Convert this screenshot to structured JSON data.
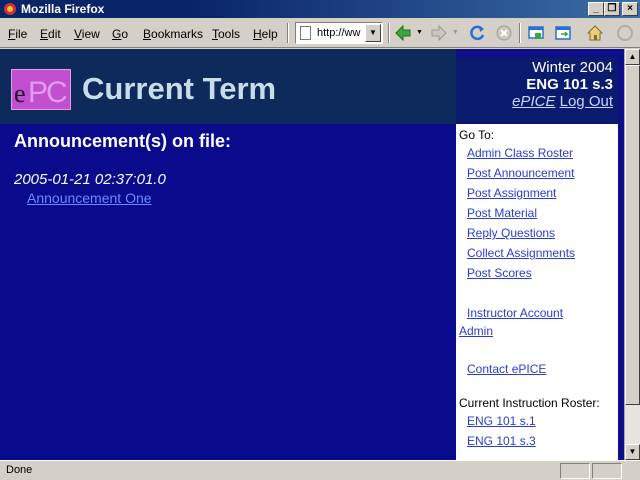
{
  "window": {
    "title": "Mozilla Firefox",
    "controls": [
      "_",
      "❐",
      "×"
    ]
  },
  "menu": {
    "items": [
      {
        "underline": "F",
        "rest": "ile"
      },
      {
        "underline": "E",
        "rest": "dit"
      },
      {
        "underline": "V",
        "rest": "iew"
      },
      {
        "underline": "G",
        "rest": "o"
      },
      {
        "underline": "B",
        "rest": "ookmarks"
      },
      {
        "underline": "T",
        "rest": "ools"
      },
      {
        "underline": "H",
        "rest": "elp"
      }
    ]
  },
  "address_bar": {
    "value": "http://ww"
  },
  "toolbar_icons": [
    "back-icon",
    "forward-icon",
    "reload-icon",
    "stop-icon",
    "open-window-icon",
    "new-tab-icon",
    "home-icon",
    "throbber-icon"
  ],
  "header": {
    "logo_e": "e",
    "logo_pc": "PC",
    "page_title": "Current Term"
  },
  "term": {
    "season": "Winter 2004",
    "course": "ENG 101 s.3",
    "epice_link": "ePICE",
    "logout_link": "Log Out"
  },
  "main": {
    "heading": "Announcement(s) on file:",
    "announcement_date": "2005-01-21 02:37:01.0",
    "announcement_title": "Announcement One"
  },
  "sidebar": {
    "goto_label": "Go To:",
    "links": [
      "Admin Class Roster",
      "Post Announcement",
      "Post Assignment",
      "Post Material",
      "Reply Questions",
      "Collect Assignments",
      "Post Scores"
    ],
    "account_link_line1": "Instructor Account",
    "account_link_line2": "Admin",
    "contact_link": "Contact ePICE",
    "roster_title": "Current Instruction Roster:",
    "roster_links": [
      "ENG 101 s.1",
      "ENG 101 s.3"
    ]
  },
  "status": {
    "text": "Done"
  },
  "colors": {
    "content_bg": "#0a0a8c",
    "header_bg": "#0e2a5c",
    "link": "#2a3bd0"
  }
}
